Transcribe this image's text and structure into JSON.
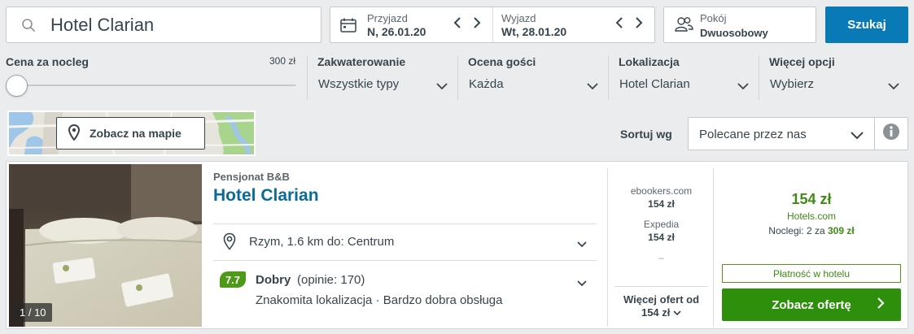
{
  "search": {
    "query": "Hotel Clarian",
    "button_label": "Szukaj"
  },
  "dates": {
    "checkin_label": "Przyjazd",
    "checkin_value": "N, 26.01.20",
    "checkout_label": "Wyjazd",
    "checkout_value": "Wt, 28.01.20"
  },
  "rooms": {
    "label": "Pokój",
    "value": "Dwuosobowy"
  },
  "filters": {
    "price": {
      "label": "Cena za nocleg",
      "max": "300 zł"
    },
    "accommodation": {
      "label": "Zakwaterowanie",
      "value": "Wszystkie typy"
    },
    "rating": {
      "label": "Ocena gości",
      "value": "Każda"
    },
    "location": {
      "label": "Lokalizacja",
      "value": "Hotel Clarian"
    },
    "more": {
      "label": "Więcej opcji",
      "value": "Wybierz"
    }
  },
  "map": {
    "button_label": "Zobacz na mapie"
  },
  "sort": {
    "label": "Sortuj wg",
    "value": "Polecane przez nas"
  },
  "result": {
    "type": "Pensjonat B&B",
    "name": "Hotel Clarian",
    "photo_counter": "1 / 10",
    "location": "Rzym, 1.6 km do: Centrum",
    "rating_score": "7.7",
    "rating_word": "Dobry",
    "rating_count": "(opinie: 170)",
    "highlights": "Znakomita lokalizacja · Bardzo dobra obsługa",
    "offers": [
      {
        "provider": "ebookers.com",
        "price": "154 zł"
      },
      {
        "provider": "Expedia",
        "price": "154 zł"
      }
    ],
    "offers_placeholder": "–",
    "more_offers_label": "Więcej ofert od",
    "more_offers_price": "154 zł",
    "best_price": "154 zł",
    "best_provider": "Hotels.com",
    "nights_text": "Noclegi: 2 za",
    "nights_total": "309 zł",
    "pay_label": "Płatność w hotelu",
    "cta_label": "Zobacz ofertę"
  },
  "colors": {
    "accent_blue": "#0a7ab6",
    "hotel_name": "#0a6b9a",
    "deal_green": "#2d8f0b",
    "rating_green": "#4c9a18"
  }
}
